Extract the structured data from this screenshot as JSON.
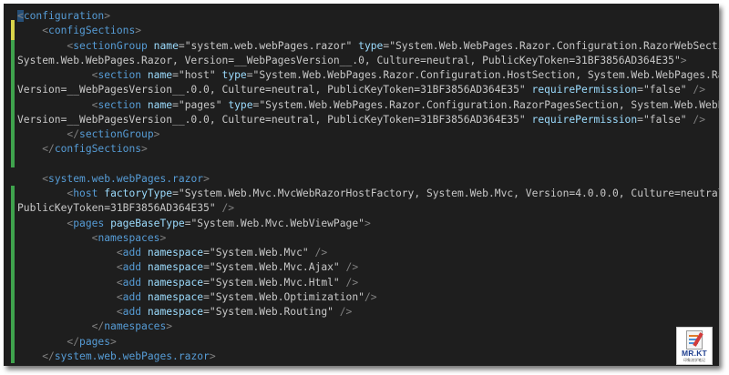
{
  "logo": {
    "name": "MR.KT",
    "tagline": "印象流学笔记"
  },
  "lines": [
    [
      [
        "b",
        "<"
      ],
      [
        "t",
        "configuration"
      ],
      [
        "b",
        ">"
      ]
    ],
    [
      [
        "v",
        "    "
      ],
      [
        "b",
        "<"
      ],
      [
        "t",
        "configSections"
      ],
      [
        "b",
        ">"
      ]
    ],
    [
      [
        "v",
        "        "
      ],
      [
        "b",
        "<"
      ],
      [
        "t",
        "sectionGroup"
      ],
      [
        "v",
        " "
      ],
      [
        "a",
        "name"
      ],
      [
        "e",
        "="
      ],
      [
        "v",
        "\"system.web.webPages.razor\""
      ],
      [
        "v",
        " "
      ],
      [
        "a",
        "type"
      ],
      [
        "e",
        "="
      ],
      [
        "v",
        "\"System.Web.WebPages.Razor.Configuration.RazorWebSectionGroup,"
      ]
    ],
    [
      [
        "v",
        "System.Web.WebPages.Razor, Version=__WebPagesVersion__.0, Culture=neutral, PublicKeyToken=31BF3856AD364E35\""
      ],
      [
        "b",
        ">"
      ]
    ],
    [
      [
        "v",
        "            "
      ],
      [
        "b",
        "<"
      ],
      [
        "t",
        "section"
      ],
      [
        "v",
        " "
      ],
      [
        "a",
        "name"
      ],
      [
        "e",
        "="
      ],
      [
        "v",
        "\"host\""
      ],
      [
        "v",
        " "
      ],
      [
        "a",
        "type"
      ],
      [
        "e",
        "="
      ],
      [
        "v",
        "\"System.Web.WebPages.Razor.Configuration.HostSection, System.Web.WebPages.Razor,"
      ]
    ],
    [
      [
        "v",
        "Version=__WebPagesVersion__.0.0, Culture=neutral, PublicKeyToken=31BF3856AD364E35\""
      ],
      [
        "v",
        " "
      ],
      [
        "a",
        "requirePermission"
      ],
      [
        "e",
        "="
      ],
      [
        "v",
        "\"false\""
      ],
      [
        "v",
        " "
      ],
      [
        "b",
        "/>"
      ]
    ],
    [
      [
        "v",
        "            "
      ],
      [
        "b",
        "<"
      ],
      [
        "t",
        "section"
      ],
      [
        "v",
        " "
      ],
      [
        "a",
        "name"
      ],
      [
        "e",
        "="
      ],
      [
        "v",
        "\"pages\""
      ],
      [
        "v",
        " "
      ],
      [
        "a",
        "type"
      ],
      [
        "e",
        "="
      ],
      [
        "v",
        "\"System.Web.WebPages.Razor.Configuration.RazorPagesSection, System.Web.WebPages.Razor,"
      ]
    ],
    [
      [
        "v",
        "Version=__WebPagesVersion__.0.0, Culture=neutral, PublicKeyToken=31BF3856AD364E35\""
      ],
      [
        "v",
        " "
      ],
      [
        "a",
        "requirePermission"
      ],
      [
        "e",
        "="
      ],
      [
        "v",
        "\"false\""
      ],
      [
        "v",
        " "
      ],
      [
        "b",
        "/>"
      ]
    ],
    [
      [
        "v",
        "        "
      ],
      [
        "b",
        "</"
      ],
      [
        "t",
        "sectionGroup"
      ],
      [
        "b",
        ">"
      ]
    ],
    [
      [
        "v",
        "    "
      ],
      [
        "b",
        "</"
      ],
      [
        "t",
        "configSections"
      ],
      [
        "b",
        ">"
      ]
    ],
    [],
    [
      [
        "v",
        "    "
      ],
      [
        "b",
        "<"
      ],
      [
        "t",
        "system.web.webPages.razor"
      ],
      [
        "b",
        ">"
      ]
    ],
    [
      [
        "v",
        "        "
      ],
      [
        "b",
        "<"
      ],
      [
        "t",
        "host"
      ],
      [
        "v",
        " "
      ],
      [
        "a",
        "factoryType"
      ],
      [
        "e",
        "="
      ],
      [
        "v",
        "\"System.Web.Mvc.MvcWebRazorHostFactory, System.Web.Mvc, Version=4.0.0.0, Culture=neutral,"
      ]
    ],
    [
      [
        "v",
        "PublicKeyToken=31BF3856AD364E35\""
      ],
      [
        "v",
        " "
      ],
      [
        "b",
        "/>"
      ]
    ],
    [
      [
        "v",
        "        "
      ],
      [
        "b",
        "<"
      ],
      [
        "t",
        "pages"
      ],
      [
        "v",
        " "
      ],
      [
        "a",
        "pageBaseType"
      ],
      [
        "e",
        "="
      ],
      [
        "v",
        "\"System.Web.Mvc.WebViewPage\""
      ],
      [
        "b",
        ">"
      ]
    ],
    [
      [
        "v",
        "            "
      ],
      [
        "b",
        "<"
      ],
      [
        "t",
        "namespaces"
      ],
      [
        "b",
        ">"
      ]
    ],
    [
      [
        "v",
        "                "
      ],
      [
        "b",
        "<"
      ],
      [
        "t",
        "add"
      ],
      [
        "v",
        " "
      ],
      [
        "a",
        "namespace"
      ],
      [
        "e",
        "="
      ],
      [
        "v",
        "\"System.Web.Mvc\""
      ],
      [
        "v",
        " "
      ],
      [
        "b",
        "/>"
      ]
    ],
    [
      [
        "v",
        "                "
      ],
      [
        "b",
        "<"
      ],
      [
        "t",
        "add"
      ],
      [
        "v",
        " "
      ],
      [
        "a",
        "namespace"
      ],
      [
        "e",
        "="
      ],
      [
        "v",
        "\"System.Web.Mvc.Ajax\""
      ],
      [
        "v",
        " "
      ],
      [
        "b",
        "/>"
      ]
    ],
    [
      [
        "v",
        "                "
      ],
      [
        "b",
        "<"
      ],
      [
        "t",
        "add"
      ],
      [
        "v",
        " "
      ],
      [
        "a",
        "namespace"
      ],
      [
        "e",
        "="
      ],
      [
        "v",
        "\"System.Web.Mvc.Html\""
      ],
      [
        "v",
        " "
      ],
      [
        "b",
        "/>"
      ]
    ],
    [
      [
        "v",
        "                "
      ],
      [
        "b",
        "<"
      ],
      [
        "t",
        "add"
      ],
      [
        "v",
        " "
      ],
      [
        "a",
        "namespace"
      ],
      [
        "e",
        "="
      ],
      [
        "v",
        "\"System.Web.Optimization\""
      ],
      [
        "b",
        "/>"
      ]
    ],
    [
      [
        "v",
        "                "
      ],
      [
        "b",
        "<"
      ],
      [
        "t",
        "add"
      ],
      [
        "v",
        " "
      ],
      [
        "a",
        "namespace"
      ],
      [
        "e",
        "="
      ],
      [
        "v",
        "\"System.Web.Routing\""
      ],
      [
        "v",
        " "
      ],
      [
        "b",
        "/>"
      ]
    ],
    [
      [
        "v",
        "            "
      ],
      [
        "b",
        "</"
      ],
      [
        "t",
        "namespaces"
      ],
      [
        "b",
        ">"
      ]
    ],
    [
      [
        "v",
        "        "
      ],
      [
        "b",
        "</"
      ],
      [
        "t",
        "pages"
      ],
      [
        "b",
        ">"
      ]
    ],
    [
      [
        "v",
        "    "
      ],
      [
        "b",
        "</"
      ],
      [
        "t",
        "system.web.webPages.razor"
      ],
      [
        "b",
        ">"
      ]
    ]
  ],
  "colors": {
    "background": "#1e1e1e",
    "bracket": "#808080",
    "tag": "#569cd6",
    "attribute": "#9cdcfe",
    "value": "#c8c8c8",
    "change_saved": "#3fa34d",
    "change_unsaved": "#d9d44a"
  }
}
